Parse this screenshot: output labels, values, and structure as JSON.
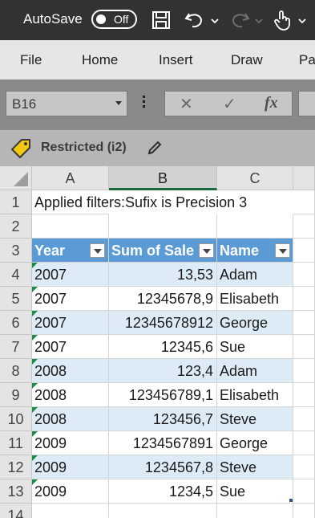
{
  "titlebar": {
    "autosave_label": "AutoSave",
    "toggle_state": "Off"
  },
  "ribbon": {
    "tabs": [
      "File",
      "Home",
      "Insert",
      "Draw",
      "Pa"
    ]
  },
  "formula_bar": {
    "name_box": "B16",
    "cancel_glyph": "✕",
    "enter_glyph": "✓",
    "fx_glyph": "fx"
  },
  "sensitivity": {
    "label": "Restricted (i2)"
  },
  "grid": {
    "columns": [
      "A",
      "B",
      "C"
    ],
    "selected_column": "B",
    "row_numbers": [
      "1",
      "2",
      "3",
      "4",
      "5",
      "6",
      "7",
      "8",
      "9",
      "10",
      "11",
      "12",
      "13",
      "14"
    ],
    "note": "Applied filters:Sufix is Precision 3",
    "headers": [
      "Year",
      "Sum of Sale",
      "Name"
    ],
    "rows": [
      [
        "2007",
        "13,53",
        "Adam"
      ],
      [
        "2007",
        "12345678,9",
        "Elisabeth"
      ],
      [
        "2007",
        "12345678912",
        "George"
      ],
      [
        "2007",
        "12345,6",
        "Sue"
      ],
      [
        "2008",
        "123,4",
        "Adam"
      ],
      [
        "2008",
        "123456789,1",
        "Elisabeth"
      ],
      [
        "2008",
        "123456,7",
        "Steve"
      ],
      [
        "2009",
        "1234567891",
        "George"
      ],
      [
        "2009",
        "1234567,8",
        "Steve"
      ],
      [
        "2009",
        "1234,5",
        "Sue"
      ]
    ]
  },
  "colors": {
    "table_header": "#5b9bd5",
    "table_band": "#ddebf7",
    "selected_col_underline": "#1d6a3e",
    "error_triangle": "#1e8a44"
  }
}
